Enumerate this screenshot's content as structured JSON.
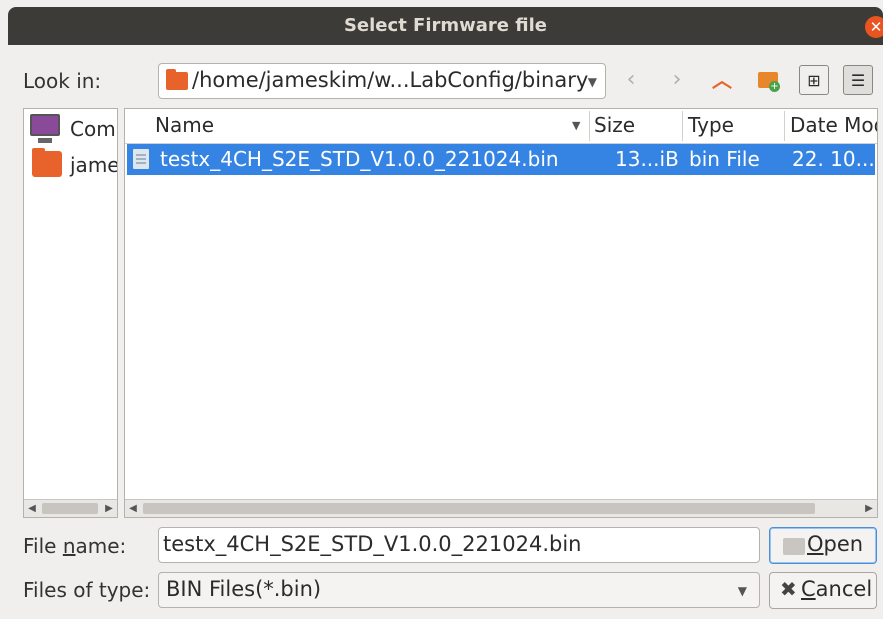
{
  "window": {
    "title": "Select Firmware file"
  },
  "look_in": {
    "label": "Look in:",
    "path": "/home/jameskim/w...LabConfig/binary"
  },
  "toolbar": {
    "back_icon": "chevron-left",
    "forward_icon": "chevron-right",
    "up_icon": "chevron-up",
    "new_folder_icon": "new-folder",
    "icon_view_icon": "grid",
    "detail_view_icon": "list"
  },
  "sidebar": {
    "items": [
      {
        "label": "Computer",
        "icon": "computer"
      },
      {
        "label": "jameskim",
        "icon": "home-folder"
      }
    ]
  },
  "file_list": {
    "columns": [
      "Name",
      "Size",
      "Type",
      "Date Modified"
    ],
    "rows": [
      {
        "name": "testx_4CH_S2E_STD_V1.0.0_221024.bin",
        "size": "13...iB",
        "type": "bin File",
        "date": "22. 10..."
      }
    ]
  },
  "file_name": {
    "label_pre": "File ",
    "label_u": "n",
    "label_post": "ame:",
    "value": "testx_4CH_S2E_STD_V1.0.0_221024.bin"
  },
  "file_type": {
    "label": "Files of type:",
    "value": "BIN Files(*.bin)"
  },
  "buttons": {
    "open_u": "O",
    "open_rest": "pen",
    "cancel_u": "C",
    "cancel_rest": "ancel"
  },
  "colors": {
    "accent": "#e95420",
    "selection": "#3584e4",
    "titlebar": "#3c3b37"
  }
}
